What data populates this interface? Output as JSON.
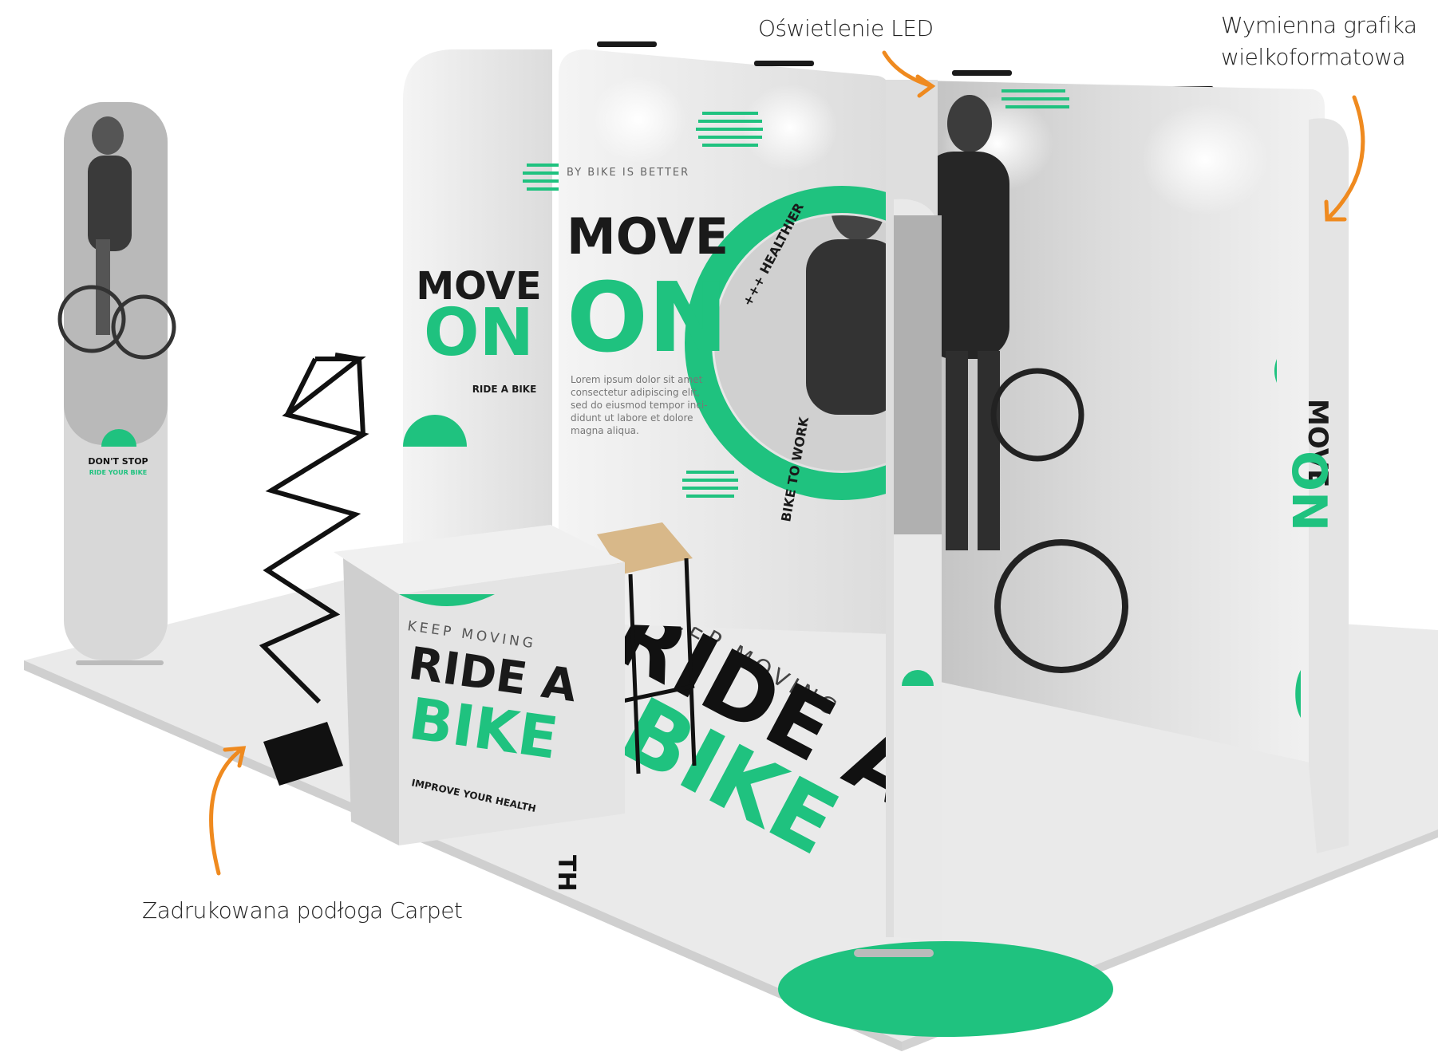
{
  "callouts": {
    "led": "Oświetlenie LED",
    "graphic_line1": "Wymienna grafika",
    "graphic_line2": "wielkoformatowa",
    "carpet": "Zadrukowana podłoga Carpet"
  },
  "booth": {
    "left_panel_headline_1": "MOVE",
    "left_panel_headline_2": "ON",
    "left_panel_tag": "RIDE A BIKE",
    "center_panel_small": "BY BIKE IS BETTER",
    "center_panel_headline_1": "MOVE",
    "center_panel_headline_2": "ON",
    "center_panel_lorem_1": "Lorem ipsum dolor sit amet",
    "center_panel_lorem_2": "consectetur adipiscing elit,",
    "center_panel_lorem_3": "sed do eiusmod tempor inci-",
    "center_panel_lorem_4": "didunt ut labore et dolore",
    "center_panel_lorem_5": "magna aliqua.",
    "circle_text_1": "+++ HEALTHIER",
    "circle_text_2": "BIKE TO WORK",
    "totem_line_1": "DON'T STOP",
    "totem_line_2": "RIDE YOUR BIKE",
    "counter_top": "KEEP MOVING",
    "counter_head_1": "RIDE A",
    "counter_head_2": "BIKE",
    "counter_bottom": "IMPROVE YOUR HEALTH",
    "floor_text_1": "KEEP MOVING",
    "floor_text_2": "RIDE A",
    "floor_text_3": "BIKE",
    "floor_text_4": "TH",
    "right_wall_1": "MOVE",
    "right_wall_2": "ON"
  },
  "colors": {
    "accent": "#1fc27f",
    "arrow": "#ef8a1f",
    "panel": "#e9e9e9",
    "dark": "#1c1c1c"
  },
  "icons": {
    "arrow": "curved-arrow-icon"
  }
}
